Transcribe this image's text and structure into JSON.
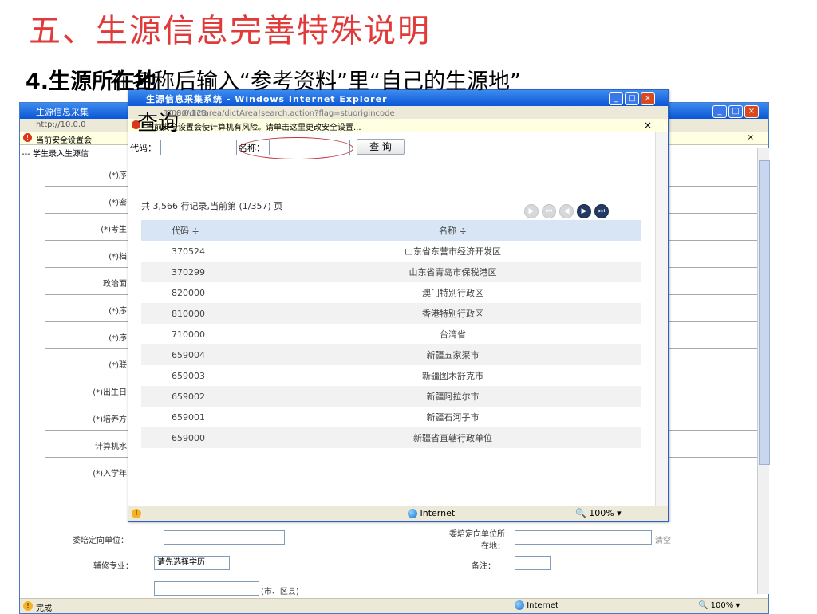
{
  "slide": {
    "title": "五、生源信息完善特殊说明",
    "line_number": "4.",
    "line_text_a": "生源所在地",
    "line_text_b": "在名称后输入“参考资料”里“自己的生源地”",
    "line_text_c": "查询"
  },
  "bg_window": {
    "title": "生源信息采集",
    "address": "http://10.0.0",
    "security": "当前安全设置会",
    "breadcrumb": "--- 学生录入生源信",
    "labels": [
      "(*)序",
      "(*)密",
      "(*)考生",
      "(*)档",
      "政治面",
      "(*)序",
      "(*)序",
      "(*)联",
      "(*)出生日",
      "(*)培养方",
      "计算机水",
      "(*)入学年"
    ],
    "row_entrust_unit_label": "委培定向单位：",
    "row_entrust_location_label": "委培定向单位所在地：",
    "clear_label": "清空",
    "minor_label": "辅修专业：",
    "minor_select_value": "请先选择学历",
    "remark_label": "备注：",
    "district_note": "(市、区县)",
    "status_text": "完成",
    "status_zone": "Internet",
    "status_zoom": "100%",
    "close_x": "×"
  },
  "popup": {
    "title": "生源信息采集系统 - Windows Internet Explorer",
    "address_host": "10.0.0.123",
    "address_path": ":8080/dictarea/dictArea!search.action?flag=stuorigincode",
    "security_msg": "当前安全设置会使计算机有风险。请单击这里更改安全设置...",
    "security_close": "×",
    "search": {
      "code_label": "代码：",
      "name_label": "名称：",
      "code_value": "",
      "name_value": "",
      "button_label": "查 询"
    },
    "page_info": "共 3,566 行记录,当前第 (1/357) 页",
    "pager_icons": [
      "first-page-icon",
      "prev-page-icon",
      "prev-icon",
      "next-page-icon",
      "last-page-icon"
    ],
    "table": {
      "headers": [
        "代码 ≑",
        "名称 ≑"
      ],
      "rows": [
        [
          "370524",
          "山东省东营市经济开发区"
        ],
        [
          "370299",
          "山东省青岛市保税港区"
        ],
        [
          "820000",
          "澳门特别行政区"
        ],
        [
          "810000",
          "香港特别行政区"
        ],
        [
          "710000",
          "台湾省"
        ],
        [
          "659004",
          "新疆五家渠市"
        ],
        [
          "659003",
          "新疆图木舒克市"
        ],
        [
          "659002",
          "新疆阿拉尔市"
        ],
        [
          "659001",
          "新疆石河子市"
        ],
        [
          "659000",
          "新疆省直辖行政单位"
        ]
      ]
    },
    "status_zone": "Internet",
    "status_zoom": "100%",
    "window_buttons": [
      "_",
      "□",
      "×"
    ]
  },
  "colors": {
    "title_red": "#e03a3a",
    "ie_blue": "#0b56d6",
    "header_blue": "#d7e5f5",
    "pager_active": "#233a62"
  }
}
